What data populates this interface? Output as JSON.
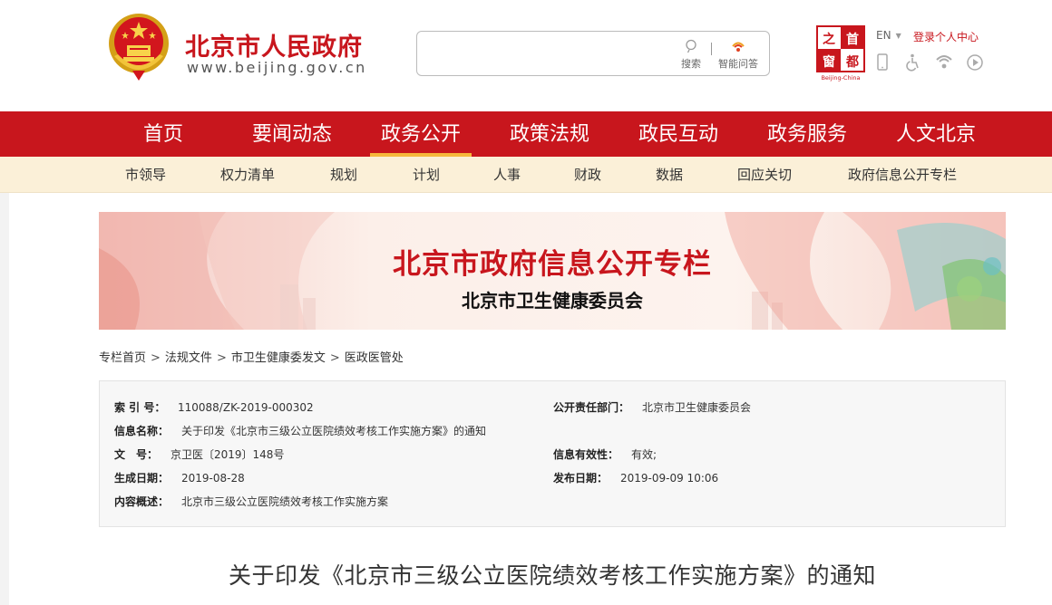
{
  "header": {
    "site_name": "北京市人民政府",
    "site_url": "www.beijing.gov.cn",
    "search": {
      "placeholder": "",
      "search_label": "搜索",
      "ai_label": "智能问答"
    },
    "capital_logo_text": "Beijing-China",
    "lang_label": "EN",
    "login_label": "登录个人中心",
    "tool_icons": [
      "mobile-icon",
      "accessibility-icon",
      "chat-icon",
      "play-icon"
    ]
  },
  "main_nav": {
    "items": [
      "首页",
      "要闻动态",
      "政务公开",
      "政策法规",
      "政民互动",
      "政务服务",
      "人文北京"
    ],
    "active_index": 2
  },
  "sub_nav": {
    "items": [
      "市领导",
      "权力清单",
      "规划",
      "计划",
      "人事",
      "财政",
      "数据",
      "回应关切",
      "政府信息公开专栏"
    ]
  },
  "banner": {
    "title": "北京市政府信息公开专栏",
    "subtitle": "北京市卫生健康委员会"
  },
  "breadcrumb": [
    "专栏首页",
    "法规文件",
    "市卫生健康委发文",
    "医政医管处"
  ],
  "info": {
    "index_label": "索 引 号：",
    "index_value": "110088/ZK-2019-000302",
    "dept_label": "公开责任部门：",
    "dept_value": "北京市卫生健康委员会",
    "name_label": "信息名称：",
    "name_value": "关于印发《北京市三级公立医院绩效考核工作实施方案》的通知",
    "docno_label": "文　号：",
    "docno_value": "京卫医〔2019〕148号",
    "validity_label": "信息有效性：",
    "validity_value": "有效;",
    "created_label": "生成日期：",
    "created_value": "2019-08-28",
    "published_label": "发布日期：",
    "published_value": "2019-09-09 10:06",
    "summary_label": "内容概述：",
    "summary_value": "北京市三级公立医院绩效考核工作实施方案"
  },
  "document_title": "关于印发《北京市三级公立医院绩效考核工作实施方案》的通知",
  "colors": {
    "brand_red": "#c8161d",
    "subnav_bg": "#fbf0d8",
    "active_underline": "#f6b83c"
  }
}
